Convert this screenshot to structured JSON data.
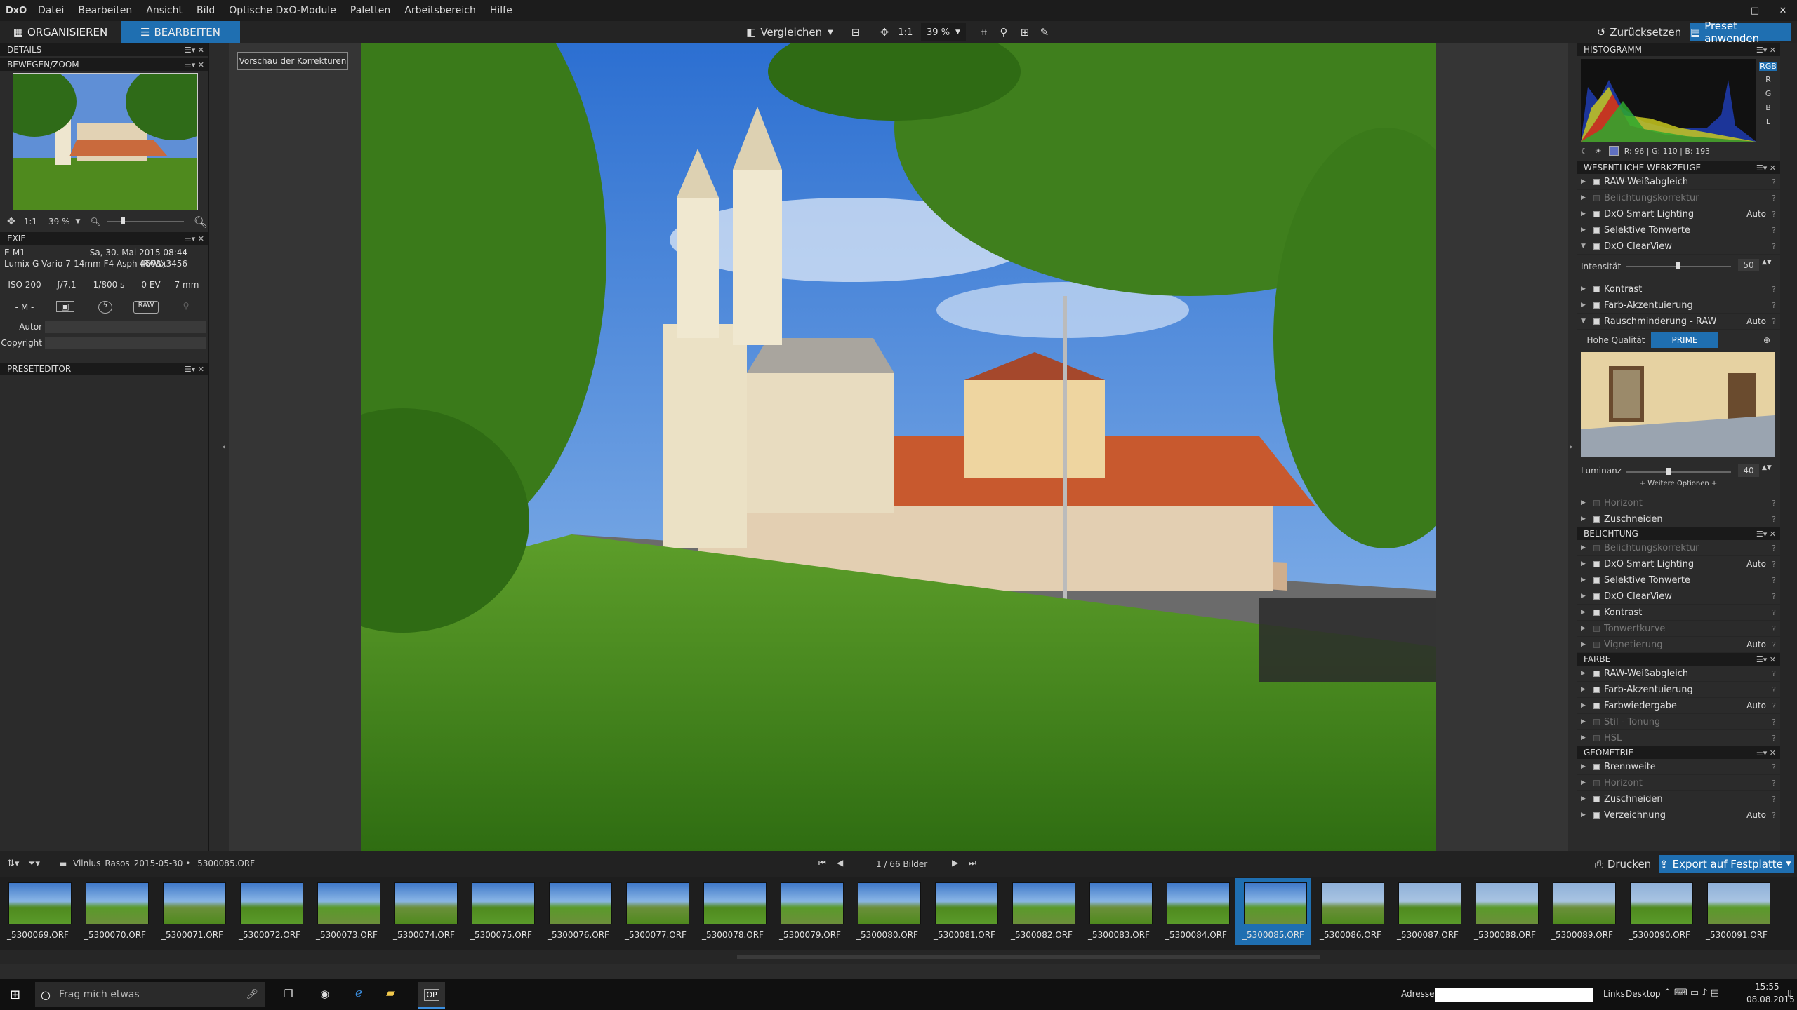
{
  "app": {
    "logo": "DxO"
  },
  "menu": [
    "Datei",
    "Bearbeiten",
    "Ansicht",
    "Bild",
    "Optische DxO-Module",
    "Paletten",
    "Arbeitsbereich",
    "Hilfe"
  ],
  "window_controls": [
    "–",
    "□",
    "✕"
  ],
  "tabs": {
    "organize": "ORGANISIEREN",
    "edit": "BEARBEITEN"
  },
  "toolbar": {
    "compare": "Vergleichen",
    "one_to_one": "1:1",
    "zoom": "39 %",
    "reset": "Zurücksetzen",
    "apply_preset": "Preset anwenden"
  },
  "left": {
    "details_title": "DETAILS",
    "move_zoom_title": "BEWEGEN/ZOOM",
    "nav_zoom_ratio": "1:1",
    "nav_zoom": "39 %",
    "exif_title": "EXIF",
    "camera": "E-M1",
    "date": "Sa, 30. Mai 2015 08:44",
    "lens": "Lumix G Vario 7-14mm F4 Asph (RAW)",
    "dimensions": "4608x3456",
    "iso": "ISO 200",
    "aperture": "ƒ/7,1",
    "shutter": "1/800 s",
    "ev": "0 EV",
    "focal": "7 mm",
    "mode": "- M -",
    "format": "RAW",
    "author_label": "Autor",
    "copyright_label": "Copyright",
    "preset_editor_title": "PRESETEDITOR"
  },
  "viewer": {
    "preview_button": "Vorschau der Korrekturen"
  },
  "right": {
    "histogram_title": "HISTOGRAMM",
    "channels": [
      "RGB",
      "R",
      "G",
      "B",
      "L"
    ],
    "pixel_readout": "R: 96 | G: 110 | B: 193",
    "essential_title": "WESENTLICHE WERKZEUGE",
    "essential_tools": [
      {
        "label": "RAW-Weißabgleich",
        "auto": "",
        "enabled": true
      },
      {
        "label": "Belichtungskorrektur",
        "auto": "",
        "enabled": false
      },
      {
        "label": "DxO Smart Lighting",
        "auto": "Auto",
        "enabled": true
      },
      {
        "label": "Selektive Tonwerte",
        "auto": "",
        "enabled": true
      },
      {
        "label": "DxO ClearView",
        "auto": "",
        "enabled": true
      }
    ],
    "intensity_label": "Intensität",
    "intensity_value": "50",
    "intensity_level": 0.5,
    "essential_tools2": [
      {
        "label": "Kontrast",
        "auto": "",
        "enabled": true
      },
      {
        "label": "Farb-Akzentuierung",
        "auto": "",
        "enabled": true
      },
      {
        "label": "Rauschminderung - RAW",
        "auto": "Auto",
        "enabled": true
      }
    ],
    "nr_high_quality": "Hohe Qualität",
    "nr_prime": "PRIME",
    "luminance_label": "Luminanz",
    "luminance_value": "40",
    "luminance_level": 0.4,
    "more_options": "+ Weitere Optionen +",
    "essential_tools3": [
      {
        "label": "Horizont",
        "auto": "",
        "enabled": false
      },
      {
        "label": "Zuschneiden",
        "auto": "",
        "enabled": true
      }
    ],
    "exposure_title": "BELICHTUNG",
    "exposure_tools": [
      {
        "label": "Belichtungskorrektur",
        "auto": "",
        "enabled": false
      },
      {
        "label": "DxO Smart Lighting",
        "auto": "Auto",
        "enabled": true
      },
      {
        "label": "Selektive Tonwerte",
        "auto": "",
        "enabled": true
      },
      {
        "label": "DxO ClearView",
        "auto": "",
        "enabled": true
      },
      {
        "label": "Kontrast",
        "auto": "",
        "enabled": true
      },
      {
        "label": "Tonwertkurve",
        "auto": "",
        "enabled": false
      },
      {
        "label": "Vignetierung",
        "auto": "Auto",
        "enabled": false
      }
    ],
    "color_title": "FARBE",
    "color_tools": [
      {
        "label": "RAW-Weißabgleich",
        "auto": "",
        "enabled": true
      },
      {
        "label": "Farb-Akzentuierung",
        "auto": "",
        "enabled": true
      },
      {
        "label": "Farbwiedergabe",
        "auto": "Auto",
        "enabled": true
      },
      {
        "label": "Stil - Tonung",
        "auto": "",
        "enabled": false
      },
      {
        "label": "HSL",
        "auto": "",
        "enabled": false
      }
    ],
    "geometry_title": "GEOMETRIE",
    "geometry_tools": [
      {
        "label": "Brennweite",
        "auto": "",
        "enabled": true
      },
      {
        "label": "Horizont",
        "auto": "",
        "enabled": false
      },
      {
        "label": "Zuschneiden",
        "auto": "",
        "enabled": true
      },
      {
        "label": "Verzeichnung",
        "auto": "Auto",
        "enabled": true
      }
    ]
  },
  "film_toolbar": {
    "path": "Vilnius_Rasos_2015-05-30 • _5300085.ORF",
    "count": "1 / 66  Bilder",
    "print": "Drucken",
    "export": "Export auf Festplatte"
  },
  "thumbnails": [
    "_5300069.ORF",
    "_5300070.ORF",
    "_5300071.ORF",
    "_5300072.ORF",
    "_5300073.ORF",
    "_5300074.ORF",
    "_5300075.ORF",
    "_5300076.ORF",
    "_5300077.ORF",
    "_5300078.ORF",
    "_5300079.ORF",
    "_5300080.ORF",
    "_5300081.ORF",
    "_5300082.ORF",
    "_5300083.ORF",
    "_5300084.ORF",
    "_5300085.ORF",
    "_5300086.ORF",
    "_5300087.ORF",
    "_5300088.ORF",
    "_5300089.ORF",
    "_5300090.ORF",
    "_5300091.ORF"
  ],
  "selected_thumbnail": "_5300085.ORF",
  "taskbar": {
    "search": "Frag mich etwas",
    "address_label": "Adresse",
    "links": "Links",
    "desktop": "Desktop",
    "time": "15:55",
    "date": "08.08.2015"
  },
  "colors": {
    "accent": "#1f6fb1"
  }
}
